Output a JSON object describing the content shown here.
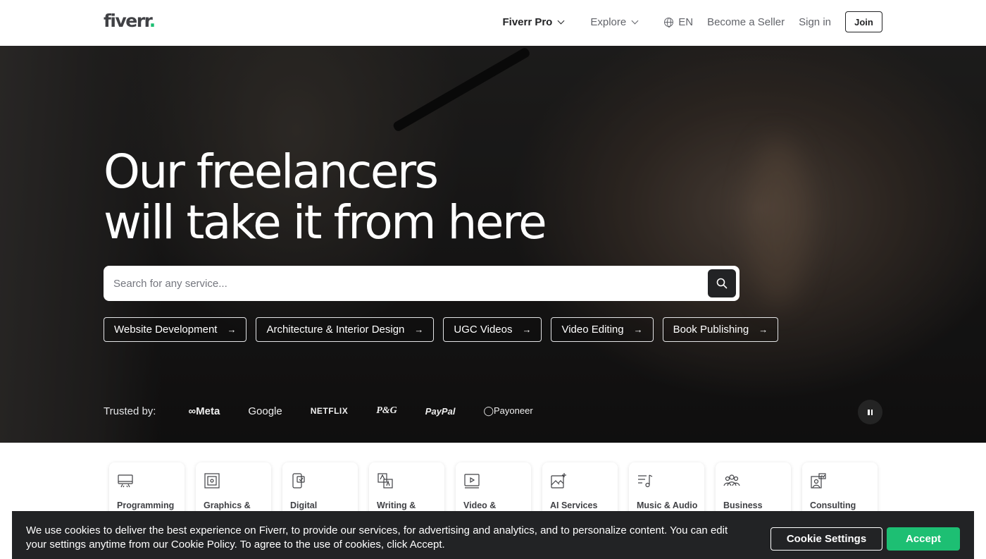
{
  "header": {
    "logo": "fiverr",
    "logo_dot": ".",
    "nav": {
      "fiverr_pro": "Fiverr Pro",
      "explore": "Explore",
      "language": "EN",
      "become_seller": "Become a Seller",
      "sign_in": "Sign in",
      "join": "Join"
    }
  },
  "hero": {
    "headline_line1": "Our freelancers",
    "headline_line2": "will take it from here",
    "search": {
      "placeholder": "Search for any service..."
    },
    "pills": [
      {
        "label": "Website Development"
      },
      {
        "label": "Architecture & Interior Design"
      },
      {
        "label": "UGC Videos"
      },
      {
        "label": "Video Editing"
      },
      {
        "label": "Book Publishing"
      }
    ],
    "pill_arrow": "→",
    "trusted_by": "Trusted by:",
    "brands": {
      "meta": "∞Meta",
      "google": "Google",
      "netflix": "NETFLIX",
      "pg": "P&G",
      "paypal": "PayPal",
      "payoneer": "◯Payoneer"
    }
  },
  "categories": [
    {
      "label": "Programming",
      "icon": "monitor-code-icon"
    },
    {
      "label": "Graphics &",
      "icon": "graphics-design-icon"
    },
    {
      "label": "Digital",
      "icon": "digital-marketing-icon"
    },
    {
      "label": "Writing &",
      "icon": "translation-icon"
    },
    {
      "label": "Video &",
      "icon": "video-play-icon"
    },
    {
      "label": "AI Services",
      "icon": "ai-image-icon"
    },
    {
      "label": "Music & Audio",
      "icon": "music-note-icon"
    },
    {
      "label": "Business",
      "icon": "people-icon"
    },
    {
      "label": "Consulting",
      "icon": "consulting-icon"
    }
  ],
  "cookie_banner": {
    "message": "We use cookies to deliver the best experience on Fiverr, to provide our services, for advertising and analytics, and to personalize content. You can edit your settings anytime from our Cookie Policy. To agree to the use of cookies, click Accept.",
    "settings_button": "Cookie Settings",
    "accept_button": "Accept"
  },
  "colors": {
    "brand_green": "#1dbf73",
    "dark": "#222325"
  }
}
